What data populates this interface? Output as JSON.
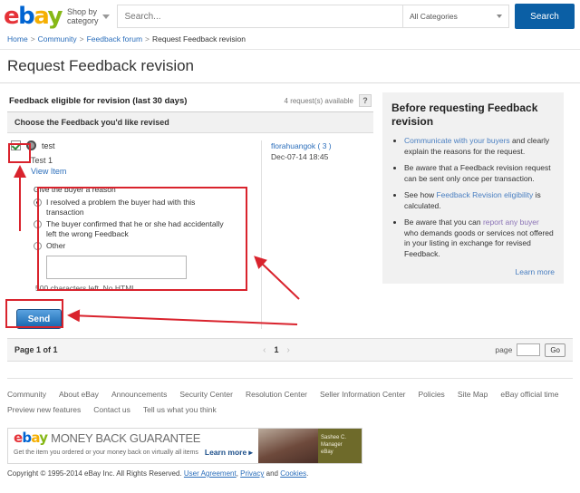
{
  "header": {
    "logo": {
      "l1": "e",
      "l2": "b",
      "l3": "a",
      "l4": "y"
    },
    "shop_by": "Shop by\ncategory",
    "shop_by_line1": "Shop by",
    "shop_by_line2": "category",
    "search_placeholder": "Search...",
    "search_value": "",
    "category_selected": "All Categories",
    "search_button": "Search"
  },
  "breadcrumb": {
    "items": [
      "Home",
      "Community",
      "Feedback forum",
      "Request Feedback revision"
    ],
    "separator": ">"
  },
  "page_title": "Request Feedback revision",
  "panel": {
    "title": "Feedback eligible for revision (last 30 days)",
    "requests_available": "4 request(s) available",
    "help_label": "?",
    "choose_bar": "Choose the Feedback you'd like revised"
  },
  "feedback": {
    "checkbox_checked": true,
    "comment": "test",
    "item_title": "Test 1",
    "view_item_link": "View Item",
    "buyer_name": "florahuangok ( 3 )",
    "date": "Dec-07-14 18:45",
    "reason_label": "Give the buyer a reason",
    "reasons": [
      {
        "label": "I resolved a problem the buyer had with this transaction",
        "selected": true
      },
      {
        "label": "The buyer confirmed that he or she had accidentally left the wrong Feedback",
        "selected": false
      },
      {
        "label": "Other",
        "selected": false
      }
    ],
    "other_value": "",
    "char_note": "500 characters left. No HTML."
  },
  "send_button": "Send",
  "sidebar": {
    "title": "Before requesting Feedback revision",
    "bullets": [
      {
        "link": "Communicate with your buyers",
        "link_color": "#4a7fc1",
        "rest": " and clearly explain the reasons for the request.",
        "before": ""
      },
      {
        "link": "",
        "rest": "",
        "before": "Be aware that a Feedback revision request can be sent only once per transaction."
      },
      {
        "before": "See how ",
        "link": "Feedback Revision eligibility",
        "link_color": "#4a7fc1",
        "rest": " is calculated."
      },
      {
        "before": "Be aware that you can ",
        "link": "report any buyer",
        "link_color": "#8a72b5",
        "rest": " who demands goods or services not offered in your listing in exchange for revised Feedback."
      }
    ],
    "learn_more": "Learn more"
  },
  "pagination": {
    "page_label": "Page 1 of 1",
    "prev": "‹",
    "current": "1",
    "next": "›",
    "page_word": "page",
    "page_input_value": "",
    "go_button": "Go"
  },
  "footer": {
    "row1": [
      "Community",
      "About eBay",
      "Announcements",
      "Security Center",
      "Resolution Center",
      "Seller Information Center",
      "Policies",
      "Site Map",
      "eBay official time"
    ],
    "row2": [
      "Preview new features",
      "Contact us",
      "Tell us what you think"
    ]
  },
  "banner": {
    "logo": {
      "l1": "e",
      "l2": "b",
      "l3": "a",
      "l4": "y"
    },
    "headline": "MONEY BACK GUARANTEE",
    "subtext": "Get the item you ordered or your money back on virtually all items",
    "learn_more": "Learn more ▸",
    "badge_line1": "Sashee C.",
    "badge_line2": "Manager",
    "badge_line3": "eBay"
  },
  "copyright": {
    "prefix": "Copyright © 1995-2014 eBay Inc. All Rights Reserved. ",
    "user_agreement": "User Agreement",
    "sep1": ", ",
    "privacy": "Privacy",
    "sep2": " and ",
    "cookies": "Cookies",
    "suffix": "."
  },
  "annotations": {
    "color": "#d9232d",
    "boxes": [
      "checkbox-highlight",
      "reason-box-highlight",
      "send-button-highlight"
    ],
    "arrows": [
      "arrow-to-checkbox",
      "arrow-to-reason-box",
      "arrow-to-send-button"
    ]
  }
}
